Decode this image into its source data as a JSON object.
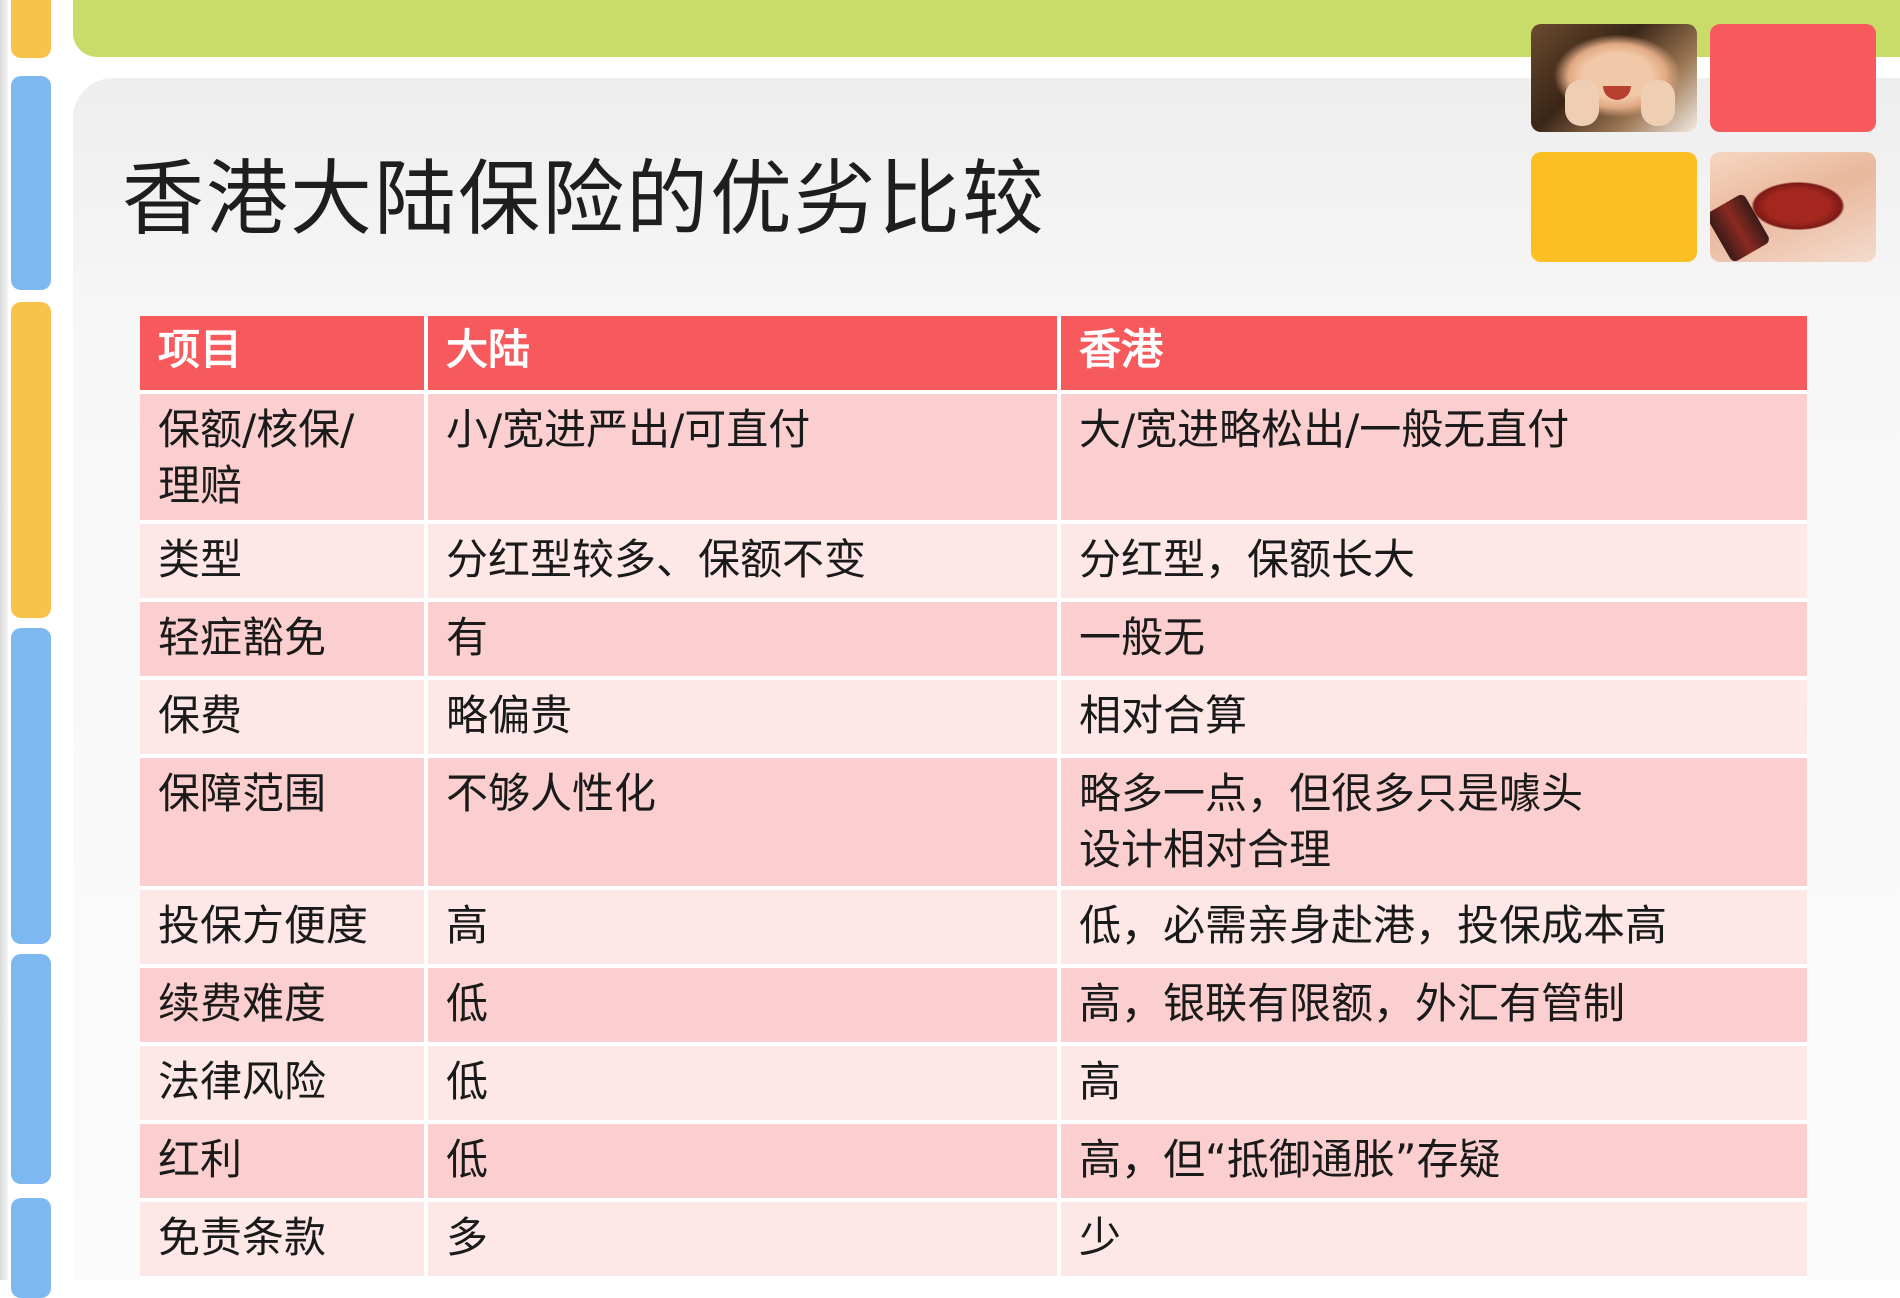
{
  "title": "香港大陆保险的优劣比较",
  "colors": {
    "top_bar": "#c9dc6a",
    "header_bg": "#f65a5c",
    "row_dark": "#fbcfcf",
    "row_light": "#fde7e7",
    "tile_red": "#f65a5c",
    "tile_yellow": "#fbbf24",
    "strip_blue": "#7db9f0",
    "strip_yellow": "#f8c34a"
  },
  "table": {
    "headers": [
      "项目",
      "大陆",
      "香港"
    ],
    "rows": [
      [
        "保额/核保/\n理赔",
        "小/宽进严出/可直付",
        "大/宽进略松出/一般无直付"
      ],
      [
        "类型",
        "分红型较多、保额不变",
        "分红型，保额长大"
      ],
      [
        "轻症豁免",
        "有",
        "一般无"
      ],
      [
        "保费",
        "略偏贵",
        "相对合算"
      ],
      [
        "保障范围",
        "不够人性化",
        "略多一点，但很多只是噱头\n设计相对合理"
      ],
      [
        "投保方便度",
        "高",
        "低，必需亲身赴港，投保成本高"
      ],
      [
        "续费难度",
        "低",
        "高，银联有限额，外汇有管制"
      ],
      [
        "法律风险",
        "低",
        "高"
      ],
      [
        "红利",
        "低",
        "高，但“抵御通胀”存疑"
      ],
      [
        "免责条款",
        "多",
        "少"
      ]
    ]
  }
}
